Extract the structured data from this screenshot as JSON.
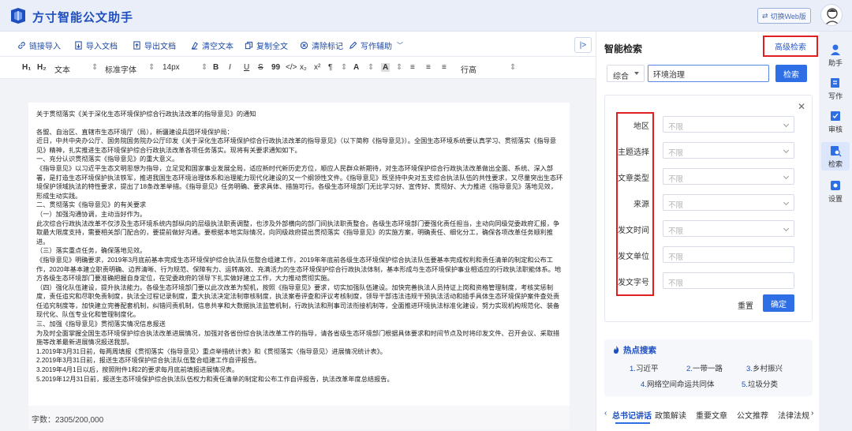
{
  "header": {
    "app_title": "方寸智能公文助手",
    "switch_label": "切换Web版"
  },
  "toolbar": {
    "items": [
      {
        "label": "链接导入",
        "icon": "link-icon"
      },
      {
        "label": "导入文档",
        "icon": "doc-import-icon"
      },
      {
        "label": "导出文档",
        "icon": "doc-export-icon"
      },
      {
        "label": "清空文本",
        "icon": "clear-icon"
      },
      {
        "label": "复制全文",
        "icon": "copy-icon"
      },
      {
        "label": "清除标记",
        "icon": "clear-mark-icon"
      },
      {
        "label": "写作辅助",
        "icon": "pen-icon"
      }
    ],
    "collapse_label": "|>"
  },
  "format_bar": {
    "h1": "H₁",
    "h2": "H₂",
    "paragraph_type": "文本",
    "font_family": "标准字体",
    "font_size": "14px",
    "line_height": "行高",
    "buttons": [
      "B",
      "I",
      "U",
      "S",
      "99",
      "</>",
      "x₂",
      "x²",
      "¶",
      "A",
      "A"
    ]
  },
  "document": {
    "paragraphs": [
      "关于贯彻落实《关于深化生态环境保护综合行政执法改革的指导意见》的通知",
      "各盟、自治区、直辖市生态环境厅（局），新疆建设兵团环境保护局：",
      "近日，中共中央办公厅、国务院国务院办公厅印发《关于深化生态环境保护综合行政执法改革的指导意见》（以下简称《指导意见》）。全国生态环境系统要认真学习、贯彻落实《指导意见》精神，扎实推进生态环境保护综合行政执法改革各项任务落实。现将有关要求通知如下。",
      "一、充分认识贯彻落实《指导意见》的重大意义。",
      "《指导意见》以习近平生态文明思想为指导，立足党和国家事业发展全局，适应新时代新历史方位，顺应人民群众新期待，对生态环境保护综合行政执法改革做出全面、系统、深入部署，是打造生态环境保护执法铁军，推进我国生态环境治理体系和治理能力现代化建设的又一个纲领性文件。《指导意见》既坚持中央对五支综合执法队伍的共性要求，又尽量突出生态环境保护领域执法的特性要求，提出了18条改革举措。《指导意见》任务明确、要求具体、措施可行。各级生态环境部门无比学习好、宣传好、贯彻好、大力推进《指导意见》落地见效，形成生动实践。",
      "二、贯彻落实《指导意见》的有关要求",
      "（一）加强沟通协调，主动当好作为。",
      "此次综合行政执法改革不仅涉及生态环境系统内部纵向的层级执法职责调整，也涉及外部横向的部门间执法职责整合。各级生态环境部门要强化责任担当，主动向同级党委政府汇报，争取最大限度支持，需要相关部门配合的，要提前做好沟通。要根据本地实际情况，向同级政府提出贯彻落实《指导意见》的实施方案，明确责任、细化分工，确保各项改革任务顺利推进。",
      "（三）落实重点任务，确保落地见效。",
      "《指导意见》明确要求，2019年3月底前基本完成生态环境保护综合执法队伍整合组建工作，2019年年底前各级生态环境保护综合执法队伍要基本完成权利和责任清单的制定和公布工作，2020年基本建立职责明确、边界清晰、行为规范、保障有力、运转高效、充满活力的生态环境保护综合行政执法体制，基本形成与生态环境保护事业相适应的行政执法职能体系。地方各级生态环境部门要准确把握自身定位，在党委政府的领导下扎实做好建立工作，大力推动贯彻实施。",
      "（四）强化队伍建设，提升执法能力。各级生态环境部门要以此次改革为契机，按照《指导意见》要求，切实加强队伍建设。加快完善执法人员持证上岗和资格管理制度，考核奖惩制度，责任追究和尽职免责制度，执法全过程记录制度，重大执法决定法制审核制度，执法案卷评查和评议考核制度，领导干部违法违规干预执法活动和插手具体生态环境保护案件查处责任追究制度等，加快建立完善配套机制，纠错问责机制，信息共享和大数据执法监管机制，行政执法和刑事司法衔接机制等，全面推进环境执法标准化建设，努力实现机构规范化、装备现代化、队伍专业化和管理制度化。",
      "三、加强《指导意见》贯彻落实情况信息报送",
      "为及时全面掌握全国生态环境保护综合执法改革进展情况，加强对各省份综合执法改革工作的指导，请各省级生态环境部门根据具体要求和时间节点及时将印发文件、召开会议、采取措施等改革最新进展情况报送我部。",
      "1.2019年3月31日前，每两周填报《贯彻落实〈指导意见〉重点举措统计表》和《贯彻落实〈指导意见〉进展情况统计表》。",
      "2.2019年3月31日前，报送生态环境保护综合执法队伍整合组建工作自评报告。",
      "3.2019年4月1日以后，按照附件1和2的要求每月底前填报进展情况表。",
      "5.2019年12月31日前，报送生态环境保护综合执法队伍权力和责任清单的制定和公布工作自评报告，执法改革年度总结报告。"
    ],
    "word_count": "字数：2305/200,000"
  },
  "search_panel": {
    "title": "智能检索",
    "advanced_label": "高级检索",
    "scope": "综合",
    "query": "环境治理",
    "search_label": "检索",
    "filters": [
      {
        "label": "地区",
        "value": "不限",
        "kind": "select"
      },
      {
        "label": "主题选择",
        "value": "不限",
        "kind": "select"
      },
      {
        "label": "文章类型",
        "value": "不限",
        "kind": "select"
      },
      {
        "label": "来源",
        "value": "不限",
        "kind": "select"
      },
      {
        "label": "发文时间",
        "value": "不限",
        "kind": "select"
      },
      {
        "label": "发文单位",
        "value": "不限",
        "kind": "input"
      },
      {
        "label": "发文字号",
        "value": "不限",
        "kind": "input"
      }
    ],
    "reset_label": "重置",
    "confirm_label": "确定",
    "hot_title": "热点搜索",
    "hot_items": [
      {
        "num": "1.",
        "text": "习近平"
      },
      {
        "num": "2.",
        "text": "一带一路"
      },
      {
        "num": "3.",
        "text": "乡村振兴"
      },
      {
        "num": "4.",
        "text": "网络空间命运共同体"
      },
      {
        "num": "5.",
        "text": "垃圾分类"
      }
    ],
    "bottom_tabs": [
      "总书记讲话",
      "政策解读",
      "重要文章",
      "公文推荐",
      "法律法规"
    ]
  },
  "right_nav": {
    "items": [
      {
        "label": "助手",
        "icon": "assistant-icon"
      },
      {
        "label": "写作",
        "icon": "write-icon"
      },
      {
        "label": "审核",
        "icon": "review-icon"
      },
      {
        "label": "检索",
        "icon": "search-icon"
      },
      {
        "label": "设置",
        "icon": "settings-icon"
      }
    ]
  },
  "colors": {
    "brand": "#1f4fbf",
    "accent": "#2f6fe6",
    "highlight_box": "#e02020"
  }
}
